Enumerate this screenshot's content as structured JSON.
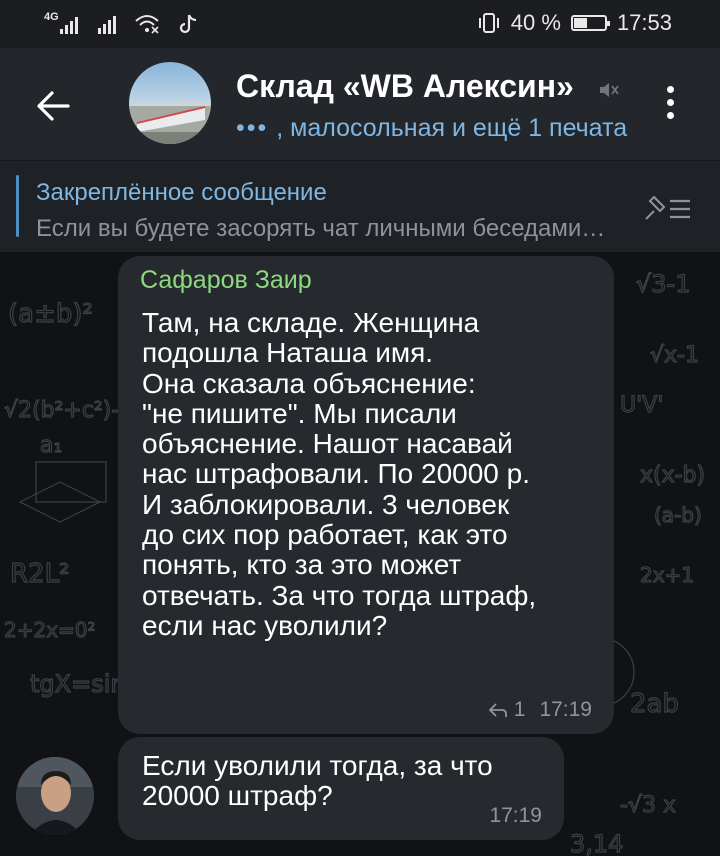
{
  "status_bar": {
    "network_label": "4G",
    "battery_text": "40 %",
    "battery_level": 0.4,
    "time": "17:53"
  },
  "header": {
    "title": "Склад «WB Алексин»",
    "subtitle_dots": "•••",
    "subtitle": ", малосольная и ещё 1 печатает",
    "icons": [
      "back-arrow-icon",
      "mute-icon",
      "more-vertical-icon"
    ]
  },
  "pinned": {
    "title": "Закреплённое сообщение",
    "text": "Если вы будете засорять чат личными беседами…"
  },
  "messages": [
    {
      "sender": "Сафаров Заир",
      "text": "Там, на складе. Женщина\nподошла Наташа имя.\nОна сказала объяснение:\n\"не пишите\". Мы писали\nобъяснение.  Нашот насавай\nнас штрафовали. По 20000 р.\nИ заблокировали. 3 человек\nдо сих пор работает, как это\nпонять, кто за это может\nотвечать. За что тогда штраф,\nесли нас уволили?",
      "replies": "1",
      "time": "17:19"
    },
    {
      "text": "Если уволили тогда, за что\n20000 штраф?",
      "time": "17:19"
    }
  ],
  "colors": {
    "header_bg": "#23262b",
    "accent_blue": "#7fb6e3",
    "sender_green": "#8ed97f",
    "bubble_bg": "#262a2f"
  }
}
